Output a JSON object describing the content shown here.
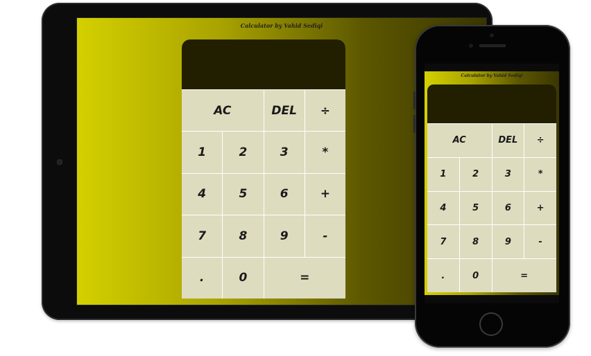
{
  "app_title": "Calculator by Vahid Sediqi",
  "colors": {
    "background_gradient_start": "#d4d000",
    "background_gradient_end": "#3a3600",
    "display_bg": "#211f00",
    "key_bg": "#dedcbe"
  },
  "display": {
    "value": ""
  },
  "keys": {
    "ac": "AC",
    "del": "DEL",
    "divide": "÷",
    "one": "1",
    "two": "2",
    "three": "3",
    "multiply": "*",
    "four": "4",
    "five": "5",
    "six": "6",
    "plus": "+",
    "seven": "7",
    "eight": "8",
    "nine": "9",
    "minus": "-",
    "dot": ".",
    "zero": "0",
    "equals": "="
  }
}
